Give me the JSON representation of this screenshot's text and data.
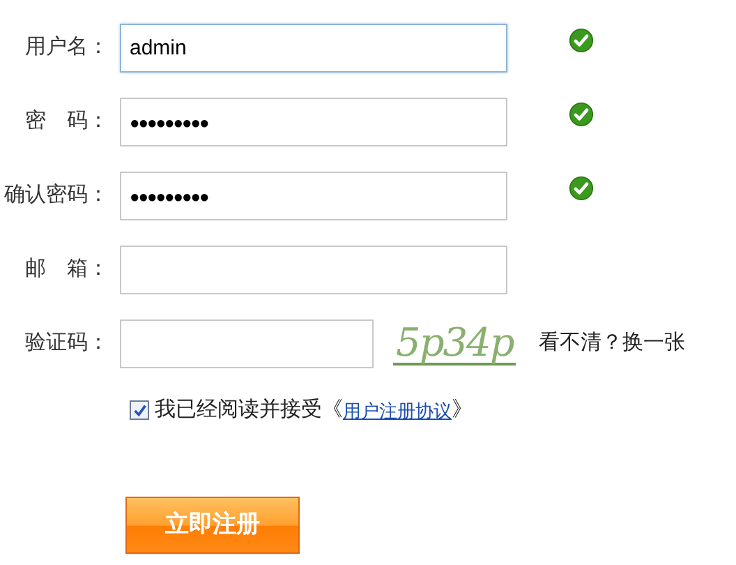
{
  "fields": [
    {
      "label": "用户名：",
      "value": "admin",
      "kind": "text",
      "valid": true,
      "focused": true
    },
    {
      "label": "密　码：",
      "value": "●●●●●●●●●",
      "kind": "password",
      "valid": true,
      "focused": false
    },
    {
      "label": "确认密码：",
      "value": "●●●●●●●●●",
      "kind": "password",
      "valid": true,
      "focused": false
    },
    {
      "label": "邮　箱：",
      "kind": "text",
      "valid": false,
      "focused": false
    }
  ],
  "captcha": {
    "label": "验证码：",
    "image_text": "5p34p",
    "refresh": "看不清？换一张"
  },
  "agreement": {
    "checked": true,
    "text": "我已经阅读并接受《",
    "link": "用户注册协议",
    "after": "》"
  },
  "submit": "立即注册"
}
